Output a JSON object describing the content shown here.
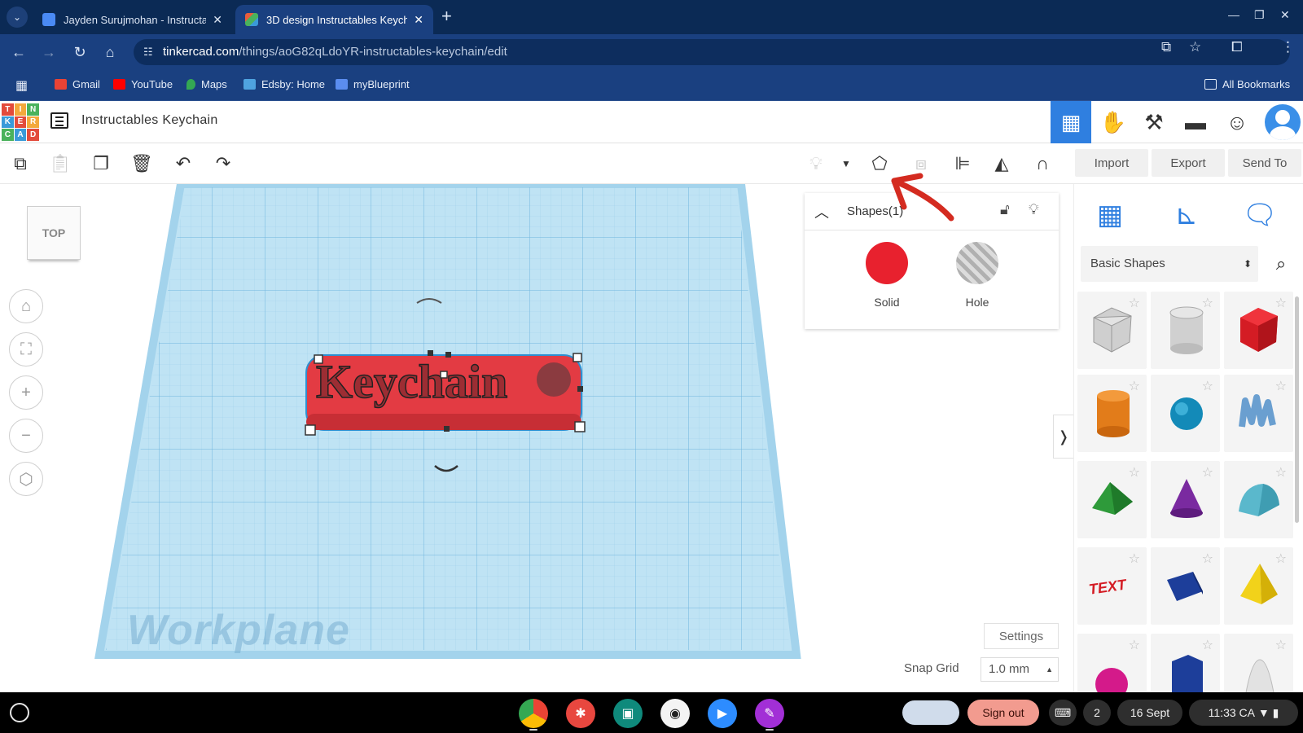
{
  "browser": {
    "tabs": [
      {
        "title": "Jayden Surujmohan - Instructab",
        "favicon_color": "#4a8af4",
        "active": false
      },
      {
        "title": "3D design Instructables Keycha",
        "favicon_color": "#e75d3c",
        "active": true
      }
    ],
    "url_host": "tinkercad.com",
    "url_path": "/things/aoG82qLdoYR-instructables-keychain/edit",
    "bookmarks": [
      {
        "label": "Gmail",
        "icon_color": "#ea4335"
      },
      {
        "label": "YouTube",
        "icon_color": "#ff0000"
      },
      {
        "label": "Maps",
        "icon_color": "#34a853"
      },
      {
        "label": "Edsby: Home",
        "icon_color": "#4fa3e0"
      },
      {
        "label": "myBlueprint",
        "icon_color": "#5b8def"
      }
    ],
    "all_bookmarks_label": "All Bookmarks"
  },
  "tinkercad": {
    "logo_letters": [
      "T",
      "I",
      "N",
      "K",
      "E",
      "R",
      "C",
      "A",
      "D"
    ],
    "design_title": "Instructables Keychain",
    "actions": {
      "import": "Import",
      "export": "Export",
      "send_to": "Send To"
    },
    "view_cube_label": "TOP",
    "workplane_label": "Workplane",
    "selected_text": "Keychain",
    "inspector": {
      "title": "Shapes(1)",
      "solid_label": "Solid",
      "hole_label": "Hole",
      "solid_color": "#e8212e"
    },
    "settings_label": "Settings",
    "snap_grid_label": "Snap Grid",
    "snap_grid_value": "1.0 mm",
    "shape_library": {
      "category": "Basic Shapes",
      "shapes": [
        "box-hole",
        "cylinder-hole",
        "box",
        "cylinder",
        "sphere",
        "scribble",
        "roof",
        "cone",
        "round-roof",
        "text",
        "half-cylinder",
        "pyramid",
        "paraboloid",
        "polygon",
        "paraboloid-white"
      ]
    }
  },
  "shelf": {
    "sign_out_label": "Sign out",
    "notification_count": "2",
    "date": "16 Sept",
    "time": "11:33",
    "region": "CA"
  },
  "colors": {
    "brand_blue": "#2f7fe0",
    "workplane_blue": "#bfe3f4",
    "annotation_red": "#d42b20"
  }
}
